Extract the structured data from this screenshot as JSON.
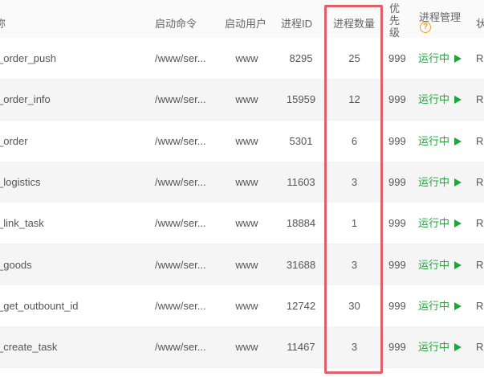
{
  "header": {
    "name": "称",
    "command": "启动命令",
    "user": "启动用户",
    "pid": "进程ID",
    "proc_count": "进程数量",
    "priority": "优先级",
    "manage": "进程管理",
    "status": "状"
  },
  "colors": {
    "running": "#20a53a",
    "highlight": "#e0606a",
    "help": "#f0a020"
  },
  "rows": [
    {
      "name": "_order_push",
      "command": "/www/ser...",
      "user": "www",
      "pid": "8295",
      "count": "25",
      "priority": "999",
      "manage": "运行中",
      "status": "R"
    },
    {
      "name": "_order_info",
      "command": "/www/ser...",
      "user": "www",
      "pid": "15959",
      "count": "12",
      "priority": "999",
      "manage": "运行中",
      "status": "R"
    },
    {
      "name": "_order",
      "command": "/www/ser...",
      "user": "www",
      "pid": "5301",
      "count": "6",
      "priority": "999",
      "manage": "运行中",
      "status": "R"
    },
    {
      "name": "_logistics",
      "command": "/www/ser...",
      "user": "www",
      "pid": "11603",
      "count": "3",
      "priority": "999",
      "manage": "运行中",
      "status": "R"
    },
    {
      "name": "_link_task",
      "command": "/www/ser...",
      "user": "www",
      "pid": "18884",
      "count": "1",
      "priority": "999",
      "manage": "运行中",
      "status": "R"
    },
    {
      "name": "_goods",
      "command": "/www/ser...",
      "user": "www",
      "pid": "31688",
      "count": "3",
      "priority": "999",
      "manage": "运行中",
      "status": "R"
    },
    {
      "name": "_get_outbount_id",
      "command": "/www/ser...",
      "user": "www",
      "pid": "12742",
      "count": "30",
      "priority": "999",
      "manage": "运行中",
      "status": "R"
    },
    {
      "name": "_create_task",
      "command": "/www/ser...",
      "user": "www",
      "pid": "11467",
      "count": "3",
      "priority": "999",
      "manage": "运行中",
      "status": "R"
    }
  ]
}
